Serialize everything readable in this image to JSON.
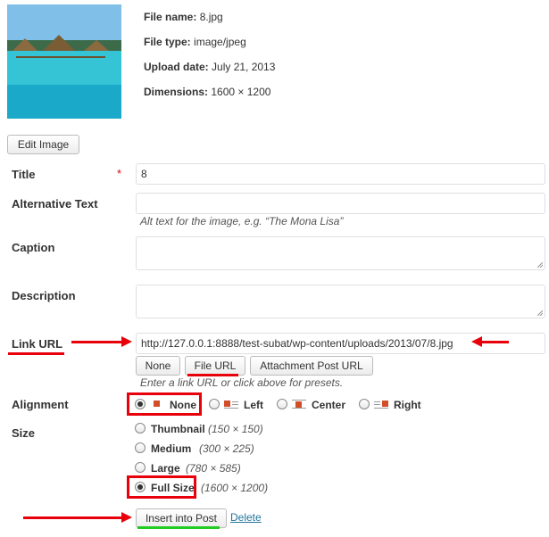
{
  "attachment": {
    "file_name_label": "File name:",
    "file_name": "8.jpg",
    "file_type_label": "File type:",
    "file_type": "image/jpeg",
    "upload_date_label": "Upload date:",
    "upload_date": "July 21, 2013",
    "dimensions_label": "Dimensions:",
    "dimensions": "1600 × 1200",
    "edit_image_label": "Edit Image"
  },
  "fields": {
    "title_label": "Title",
    "required_mark": "*",
    "title_value": "8",
    "alt_label": "Alternative Text",
    "alt_value": "",
    "alt_help": "Alt text for the image, e.g. “The Mona Lisa”",
    "caption_label": "Caption",
    "caption_value": "",
    "description_label": "Description",
    "description_value": "",
    "link_url_label": "Link URL",
    "link_url_value": "http://127.0.0.1:8888/test-subat/wp-content/uploads/2013/07/8.jpg",
    "link_buttons": [
      "None",
      "File URL",
      "Attachment Post URL"
    ],
    "link_help": "Enter a link URL or click above for presets."
  },
  "alignment": {
    "label": "Alignment",
    "options": [
      "None",
      "Left",
      "Center",
      "Right"
    ],
    "selected": "None"
  },
  "size": {
    "label": "Size",
    "options": [
      {
        "name": "Thumbnail",
        "dims": "(150 × 150)"
      },
      {
        "name": "Medium",
        "dims": "(300 × 225)"
      },
      {
        "name": "Large",
        "dims": "(780 × 585)"
      },
      {
        "name": "Full Size",
        "dims": "(1600 × 1200)"
      }
    ],
    "selected": "Full Size"
  },
  "actions": {
    "insert_label": "Insert into Post",
    "delete_label": "Delete"
  },
  "colors": {
    "annotation_red": "#e8000b",
    "annotation_green": "#22cc22",
    "link_blue": "#21759b"
  }
}
